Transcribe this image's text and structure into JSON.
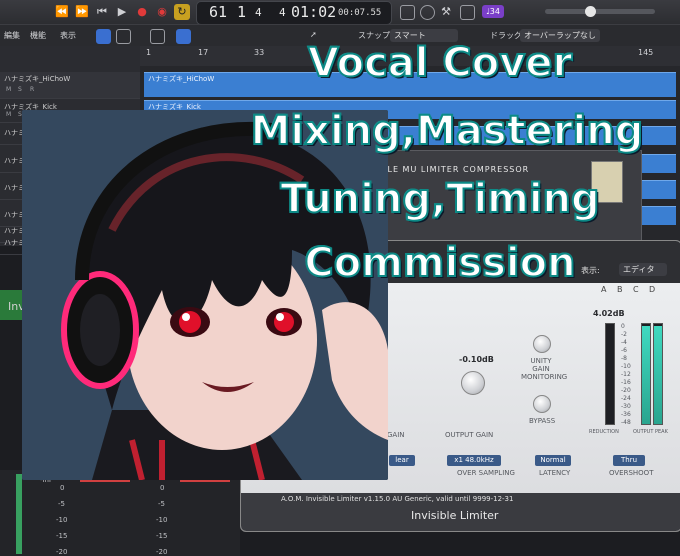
{
  "transport": {
    "bars": "61",
    "beat": "1",
    "div": "4",
    "tick": "4",
    "time": "01:02",
    "time_fine": "00:07.55",
    "badge": "♩34"
  },
  "toolbar": {
    "edit_label": "編集",
    "function_label": "機能",
    "view_label": "表示",
    "snap_label": "スナップ:",
    "snap_value": "スマート",
    "drag_label": "ドラッグ:",
    "drag_value": "オーバーラップなし"
  },
  "ruler": {
    "marks": [
      "1",
      "17",
      "33",
      "145"
    ]
  },
  "tracks": [
    {
      "name": "ハナミズキ_HiChoW"
    },
    {
      "name": "ハナミズキ_Kick"
    },
    {
      "name": "ハナミ"
    },
    {
      "name": "ハナミ"
    },
    {
      "name": "ハナミ"
    },
    {
      "name": "ハナミ"
    },
    {
      "name": "ハナミ"
    },
    {
      "name": "ハナミ"
    }
  ],
  "regions": [
    {
      "name": "ハナミズキ_HiChoW"
    },
    {
      "name": "ハナミズキ_Kick"
    }
  ],
  "compressor": {
    "title": "BLE MU LIMITER COMPRESSOR"
  },
  "plugin": {
    "view_label": "表示:",
    "view_value": "エディタ",
    "presets": [
      "A",
      "B",
      "C",
      "D"
    ],
    "output_db": "4.02dB",
    "output_gain_value": "-0.10dB",
    "gain_label": "GAIN",
    "output_gain_label": "OUTPUT GAIN",
    "unity_label": "UNITY GAIN MONITORING",
    "bypass_label": "BYPASS",
    "oversampling_value": "x1 48.0kHz",
    "oversampling_label": "OVER SAMPLING",
    "latency_value": "Normal",
    "latency_label": "LATENCY",
    "overshoot_value": "Thru",
    "overshoot_label": "OVERSHOOT",
    "mode_value": "lear",
    "reduction_label": "REDUCTION",
    "output_peak_label": "OUTPUT PEAK",
    "footer_line": "A.O.M. Invisible Limiter v1.15.0 AU Generic, valid until 9999-12-31",
    "name": "Invisible Limiter",
    "scale": [
      "0",
      "-2",
      "-4",
      "-6",
      "-8",
      "-10",
      "-12",
      "-16",
      "-20",
      "-24",
      "-30",
      "-36",
      "-48"
    ]
  },
  "mixer": {
    "inf1": "-inf",
    "inf2": "-inf",
    "scale": [
      "0",
      "-5",
      "-10",
      "-15",
      "-20"
    ],
    "side_text": "Invi"
  },
  "overlay": {
    "line1": "Vocal Cover",
    "line2": "Mixing,Mastering",
    "line3": "Tuning,Timing",
    "line4": "Commission"
  }
}
